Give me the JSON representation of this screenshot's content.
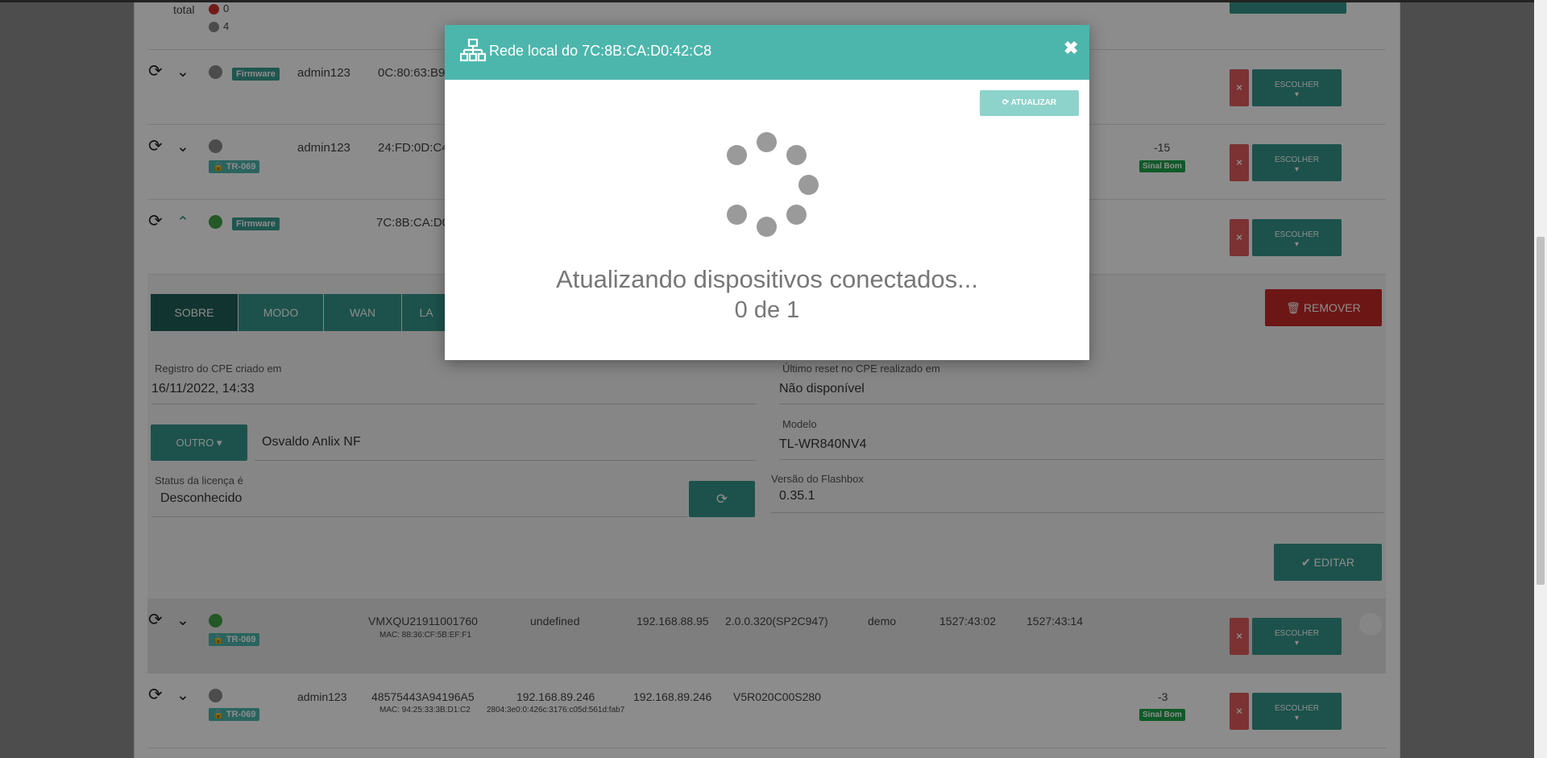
{
  "summary": {
    "total_label": "total",
    "count_red": "0",
    "count_grey": "4"
  },
  "rows": [
    {
      "badge": "Firmware",
      "user": "admin123",
      "mac": "0C:80:63:B9:..."
    },
    {
      "badge": "TR-069",
      "user": "admin123",
      "mac": "24:FD:0D:C4:...",
      "signal_value": "-15",
      "signal_label": "Sinal Bom"
    },
    {
      "badge": "Firmware",
      "mac": "7C:8B:CA:D0:..."
    },
    {
      "badge": "TR-069",
      "serial": "VMXQU21911001760",
      "submac": "MAC: 88:36:CF:5B:EF:F1",
      "c1": "undefined",
      "c2": "192.168.88.95",
      "c3": "2.0.0.320(SP2C947)",
      "c4": "demo",
      "c5": "1527:43:02",
      "c6": "1527:43:14"
    },
    {
      "badge": "TR-069",
      "user": "admin123",
      "serial": "48575443A94196A5",
      "submac": "MAC: 94:25:33:3B:D1:C2",
      "c1": "192.168.89.246",
      "ipv6": "2804:3e0:0:426c:3176:c05d:561d:fab7",
      "c2": "192.168.89.246",
      "c3": "V5R020C00S280",
      "signal_value": "-3",
      "signal_label": "Sinal Bom"
    }
  ],
  "buttons": {
    "x": "×",
    "escolher": "ESCOLHER",
    "chevron": "▾"
  },
  "tabs": [
    "SOBRE",
    "MODO",
    "WAN",
    "LA"
  ],
  "details": {
    "remove_label": "REMOVER",
    "created_label": "Registro do CPE criado em",
    "created_value": "16/11/2022, 14:33",
    "reset_label": "Último reset no CPE realizado em",
    "reset_value": "Não disponível",
    "other_label": "OUTRO ▾",
    "owner_value": "Osvaldo Anlix NF",
    "model_label": "Modelo",
    "model_value": "TL-WR840NV4",
    "license_label": "Status da licença é",
    "license_value": "Desconhecido",
    "flashbox_label": "Versão do Flashbox",
    "flashbox_value": "0.35.1",
    "edit_label": "EDITAR"
  },
  "modal": {
    "title": "Rede local do 7C:8B:CA:D0:42:C8",
    "close": "✖",
    "update_label": "ATUALIZAR",
    "loading_text": "Atualizando dispositivos conectados...",
    "progress": "0 de 1"
  },
  "colors": {
    "teal": "#4db6ac",
    "teal_dark": "#36958b",
    "danger": "#c62828",
    "success": "#1ea54a"
  }
}
